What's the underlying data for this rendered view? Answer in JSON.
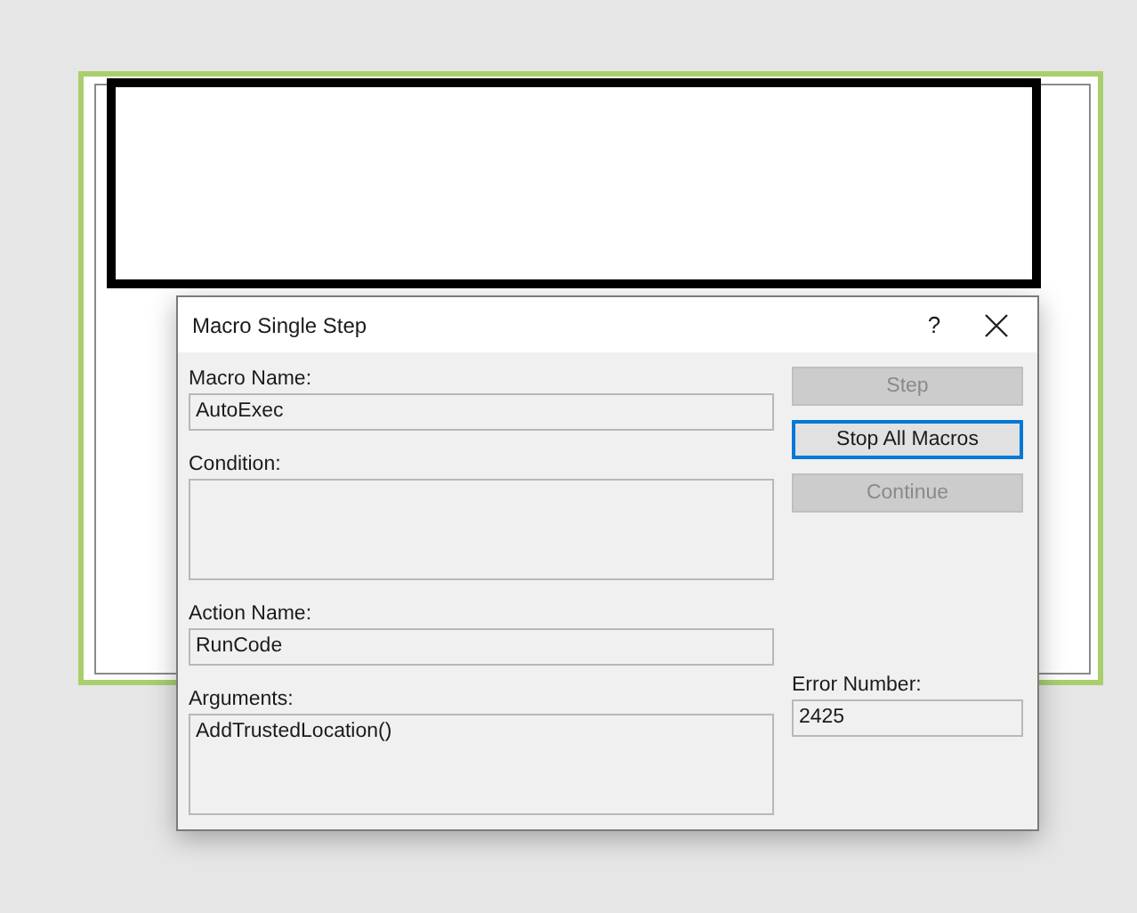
{
  "dialog": {
    "title": "Macro Single Step",
    "help": "?"
  },
  "fields": [
    {
      "label": "Macro Name:",
      "value": "AutoExec",
      "kind": "single"
    },
    {
      "label": "Condition:",
      "kind": "multi"
    },
    {
      "label": "Action Name:",
      "value": "RunCode",
      "kind": "single"
    },
    {
      "label": "Arguments:",
      "value": "AddTrustedLocation()",
      "kind": "multi"
    }
  ],
  "buttons": [
    {
      "label": "Step",
      "disabled": true,
      "focused": false
    },
    {
      "label": "Stop All Macros",
      "disabled": false,
      "focused": true
    },
    {
      "label": "Continue",
      "disabled": true,
      "focused": false
    }
  ],
  "error": {
    "label": "Error Number:",
    "value": "2425"
  }
}
